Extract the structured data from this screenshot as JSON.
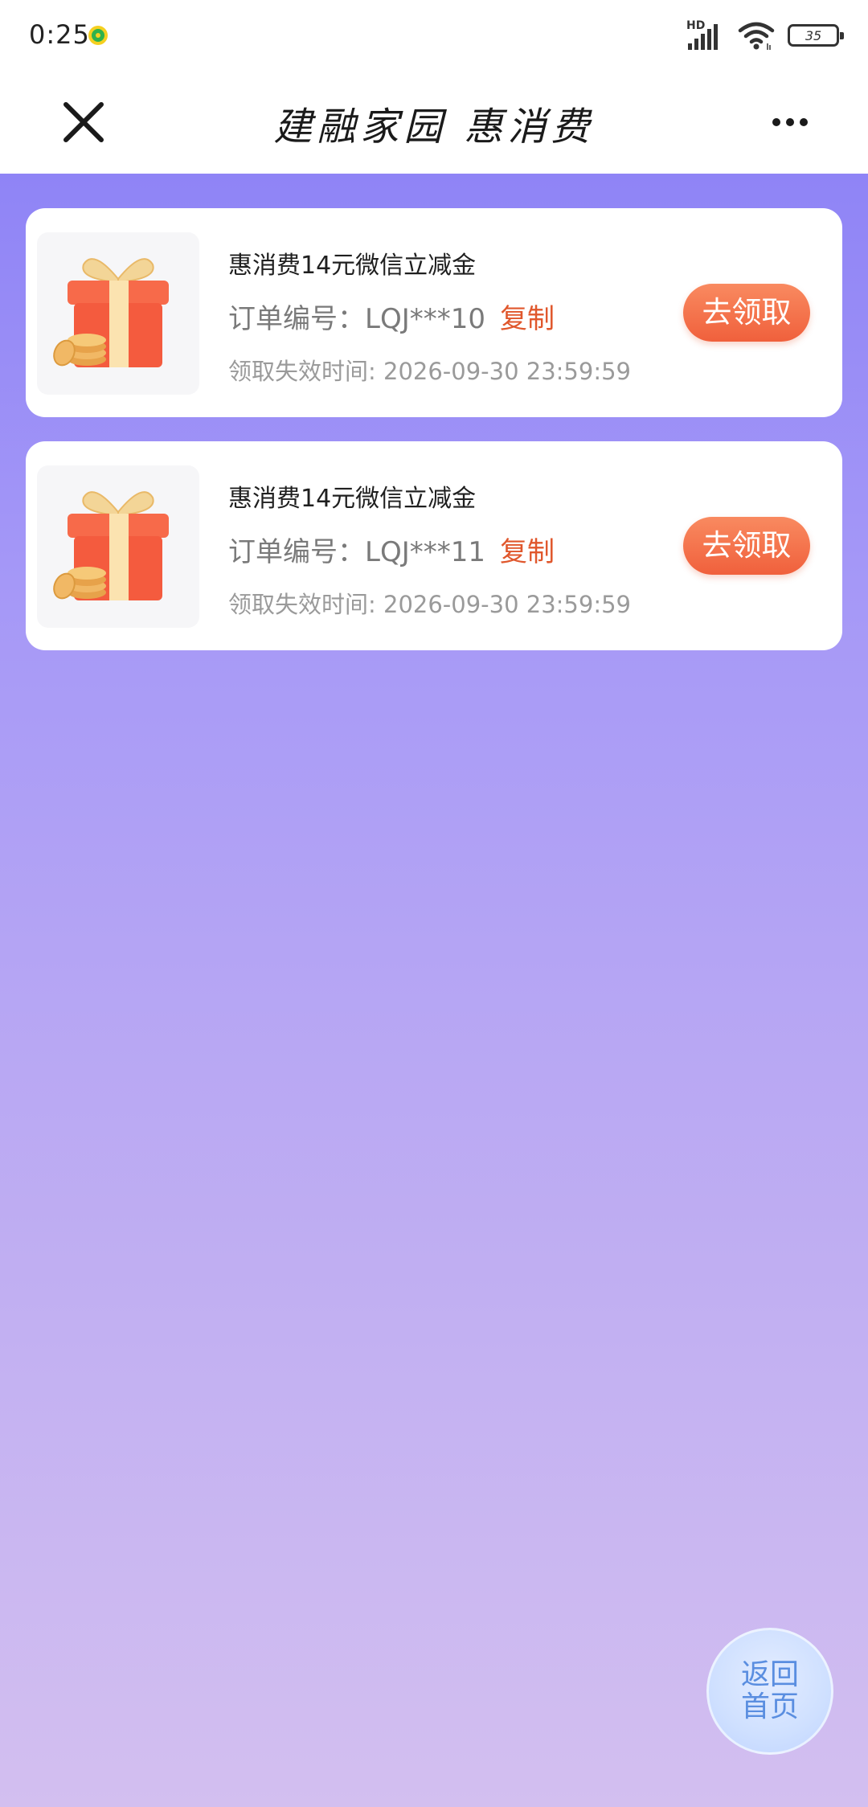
{
  "status_bar": {
    "time": "0:25",
    "network_label": "HD",
    "battery_level": "35"
  },
  "nav": {
    "title": "建融家园 惠消费"
  },
  "coupons": [
    {
      "title": "惠消费14元微信立减金",
      "order_label": "订单编号：LQJ***10",
      "copy_label": "复制",
      "expire_text": "领取失效时间: 2026-09-30 23:59:59",
      "claim_label": "去领取"
    },
    {
      "title": "惠消费14元微信立减金",
      "order_label": "订单编号：LQJ***11",
      "copy_label": "复制",
      "expire_text": "领取失效时间: 2026-09-30 23:59:59",
      "claim_label": "去领取"
    }
  ],
  "home_button": {
    "label": "返回首页"
  },
  "colors": {
    "accent": "#e0572c",
    "claim_button": "#f0603c",
    "background_top": "#8f84f6",
    "background_bottom": "#d3bff0"
  }
}
